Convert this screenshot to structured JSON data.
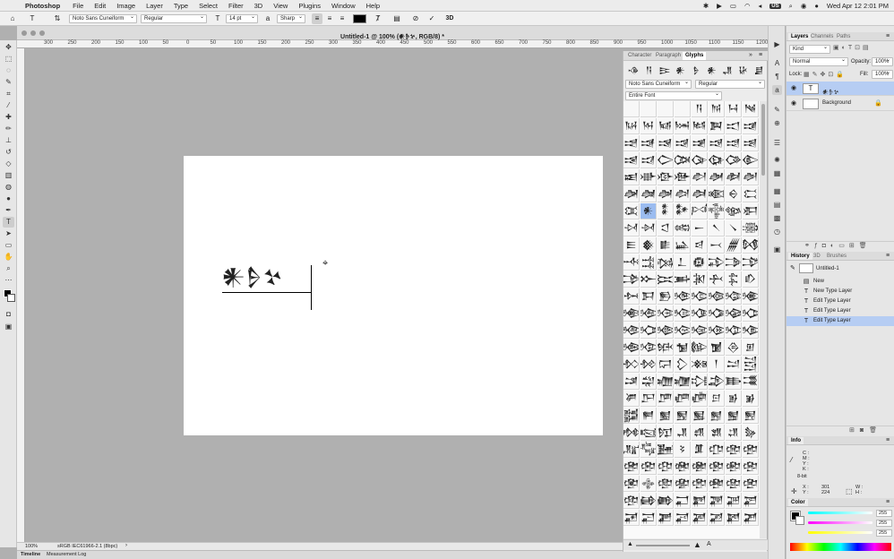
{
  "menubar": {
    "app": "Photoshop",
    "items": [
      "File",
      "Edit",
      "Image",
      "Layer",
      "Type",
      "Select",
      "Filter",
      "3D",
      "View",
      "Plugins",
      "Window",
      "Help"
    ],
    "input_source": "US",
    "datetime": "Wed Apr 12  2:01 PM"
  },
  "options": {
    "font_family": "Noto Sans Cuneiform",
    "font_style": "Regular",
    "font_size": "14 pt",
    "antialias": "Sharp",
    "text_color": "#000000",
    "toggle_3d": "3D"
  },
  "document": {
    "title": "Untitled-1 @ 100% (𒀭𒊩𒆳, RGB/8) *",
    "canvas_text": "𒀭𒊩𒆳",
    "zoom": "100%",
    "profile": "sRGB IEC61966-2.1 (8bpc)"
  },
  "ruler_ticks": [
    "300",
    "250",
    "200",
    "150",
    "100",
    "50",
    "0",
    "50",
    "100",
    "150",
    "200",
    "250",
    "300",
    "350",
    "400",
    "450",
    "500",
    "550",
    "600",
    "650",
    "700",
    "750",
    "800",
    "850",
    "900",
    "950",
    "1000",
    "1050",
    "1100",
    "1150",
    "1200"
  ],
  "bottom_tabs": [
    "Timeline",
    "Measurement Log"
  ],
  "glyphs_panel": {
    "tabs": [
      "Character",
      "Paragraph",
      "Glyphs"
    ],
    "recent": [
      "𒈾",
      "𒀀",
      "𒄿",
      "𒀭",
      "𒊩",
      "𒀭",
      "𒂗",
      "𒄩",
      "𒋗"
    ],
    "font": "Noto Sans Cuneiform",
    "style": "Regular",
    "show": "Entire Font",
    "glyphs": "𒀀𒀁𒀂𒀃𒀄𒀅𒀆𒀇𒀈𒀉𒀊𒀋𒀌𒀍𒀎𒀏𒀐𒀑𒀒𒀓𒀔𒀕𒀖𒀗𒀘𒀙𒀚𒀛𒀜𒀝𒀞𒀟𒀠𒀡𒀢𒀣𒀤𒀥𒀦𒀧𒀨𒀩𒀪𒀫𒀬𒀭𒀮𒀯𒀰𒀱𒀲𒀳𒀴𒀵𒀶𒀷𒀸𒀹𒀺𒀻𒀼𒀽𒀾𒀿𒁀𒁁𒁂𒁃𒁄𒁅𒁆𒁇𒁈𒁉𒁊𒁋𒁌𒁍𒁎𒁏𒁐𒁑𒁒𒁓𒁔𒁕𒁖𒁗𒁘𒁙𒁚𒁛𒁜𒁝𒁞𒁟𒁠𒁡𒁢𒁣𒁤𒁥𒁦𒁧𒁨𒁩𒁪𒁫𒁬𒁭𒁮𒁯𒁰𒁱𒁲𒁳𒁴𒁵𒁶𒁷𒁸𒁹𒁺𒁻𒁼𒁽𒁾𒁿𒂀𒂁𒂂𒂃𒂄𒂅𒂆𒂇𒂈𒂉𒂊𒂋𒂌𒂍𒂎𒂏𒂐𒂑𒂒𒂓𒂔𒂕𒂖𒂗𒂘𒂙𒂚𒂛𒂜𒂝𒂞𒂟𒂠𒂡𒂢𒂣𒂤𒂥𒂦𒂧𒂨𒂩𒂪𒂫𒂬𒂭𒂮𒂯𒂰𒂱𒂲𒂳𒂴𒂵𒂶𒂷𒂸𒂹𒂺𒂻𒂼𒂽𒂾𒂿𒃀𒃁𒃂𒃃𒃄𒃅𒃆𒃇𒃈𒃉𒃊𒃋𒃌𒃍𒃎𒃏𒃐𒃑𒃒𒃓𒃔𒃕𒃖𒃗𒃘𒃙𒃚𒃛𒃜𒃝𒃞𒃟𒃠𒃡𒃢𒃣𒃤𒃥𒃦𒃧𒃨𒃩𒃪𒃫𒃬𒃭𒃮𒃯𒃰𒃱𒃲𒃳𒃴𒃵𒃶𒃷𒃸𒃹𒃺𒃻𒃼𒃽𒃾𒃿𒄀𒄁𒄂𒄃𒄄𒄅𒄆𒄇𒄈𒄉𒄊𒄋𒄌𒄍𒄎𒄏𒄐𒄑𒄒𒄓𒄔𒄕𒄖𒄗𒄘𒄙𒄚𒄛𒄜𒄝𒄞𒄟𒄠𒄡𒄢𒄣𒄤𒄥𒄦𒄧𒄨𒄩𒄪𒄫𒄬𒄭𒄮𒄯𒄰𒄱𒄲𒄳𒄴𒄵𒄶𒄷𒄸𒄹𒄺𒄻𒄼𒄽𒄾𒄿𒅀𒅁𒅂𒅃𒅄𒅅𒅆𒅇𒅈𒅉𒅊𒅋𒅌𒅍𒅎𒅏𒅐𒅑𒅒𒅓𒅔𒅕𒅖𒅗𒅘𒅙𒅚𒅛𒅜𒅝𒅞𒅟𒅠𒅡𒅢𒅣𒅤𒅥𒅦𒅧𒅨𒅩𒅪𒅫𒅬𒅭𒅮𒅯𒅰𒅱𒅲𒅳𒅴𒅵𒅶𒅷𒅸𒅹𒅺𒅻𒅼𒅽𒅾𒅿𒆀𒆁𒆂𒆃𒆄𒆅𒆆𒆇𒆈𒆉𒆊𒆋𒆌𒆍𒆎𒆏𒆐𒆑𒆒𒆓𒆔𒆕𒆖𒆗𒆘𒆙𒆚𒆛𒆜𒆝𒆞𒆟𒆠𒆡𒆢𒆣𒆤𒆥𒆦𒆧𒆨𒆩𒆪𒆫𒆬𒆭𒆮𒆯𒆰𒆱𒆲𒆳𒆴𒆵𒆶𒆷𒆸𒆹𒆺𒆻𒆼𒆽𒆾𒆿𒇀𒇁𒇂𒇃𒇄𒇅𒇆𒇇𒇈𒇉𒇊𒇋𒇌𒇍𒇎𒇏𒇐𒇑𒇒𒇓𒇔𒇕𒇖𒇗𒇘𒇙𒇚𒇛𒇜𒇝𒇞𒇟𒇠𒇡𒇢𒇣𒇤𒇥𒇦𒇧𒇨𒇩𒇪𒇫𒇬𒇭𒇮𒇯𒇰𒇱𒇲𒇳𒇴𒇵𒇶𒇷𒇸𒇹𒇺𒇻𒇼𒇽𒇾𒇿"
  },
  "layers_panel": {
    "tabs": [
      "Layers",
      "Channels",
      "Paths"
    ],
    "kind": "Kind",
    "blend_mode": "Normal",
    "opacity_label": "Opacity:",
    "opacity": "100%",
    "lock_label": "Lock:",
    "fill_label": "Fill:",
    "fill": "100%",
    "layers": [
      {
        "name": "𒀭𒊩𒆳",
        "thumb": "T",
        "selected": true
      },
      {
        "name": "Background",
        "thumb": "",
        "selected": false
      }
    ]
  },
  "history_panel": {
    "tabs": [
      "History",
      "3D",
      "Brushes"
    ],
    "snapshot": "Untitled-1",
    "states": [
      "New",
      "New Type Layer",
      "Edit Type Layer",
      "Edit Type Layer",
      "Edit Type Layer"
    ]
  },
  "info_panel": {
    "title": "Info",
    "c": "C :",
    "m": "M :",
    "y": "Y :",
    "k": "K :",
    "bit": "8-bit",
    "x_label": "X :",
    "x": "301",
    "y_label": "Y :",
    "y_val": "224",
    "w": "W :",
    "h": "H :"
  },
  "color_panel": {
    "title": "Color",
    "r": "255",
    "g": "255",
    "b": "255"
  },
  "colors": {
    "selection": "#b6cdf3",
    "highlight": "#9bbcf0"
  }
}
